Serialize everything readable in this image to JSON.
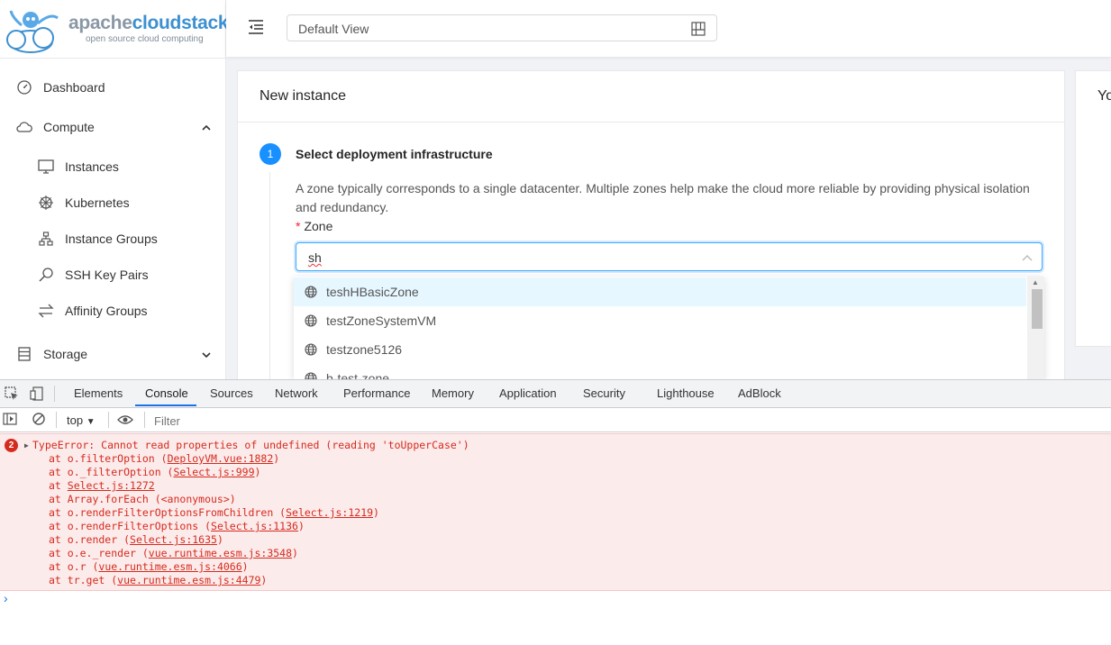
{
  "brand": {
    "name_a": "apache",
    "name_b": "cloudstack",
    "tm": "™",
    "tagline": "open source cloud computing"
  },
  "sidebar": {
    "items": [
      {
        "label": "Dashboard",
        "icon": "dashboard-icon"
      },
      {
        "label": "Compute",
        "icon": "cloud-icon",
        "expanded": true
      },
      {
        "label": "Instances",
        "icon": "desktop-icon"
      },
      {
        "label": "Kubernetes",
        "icon": "kubernetes-icon"
      },
      {
        "label": "Instance Groups",
        "icon": "cluster-icon"
      },
      {
        "label": "SSH Key Pairs",
        "icon": "key-icon"
      },
      {
        "label": "Affinity Groups",
        "icon": "swap-icon"
      },
      {
        "label": "Storage",
        "icon": "database-icon",
        "expanded": false
      }
    ]
  },
  "header": {
    "view_select": "Default View"
  },
  "wizard": {
    "title": "New instance",
    "step_number": "1",
    "step_title": "Select deployment infrastructure",
    "step_desc": "A zone typically corresponds to a single datacenter. Multiple zones help make the cloud more reliable by providing physical isolation and redundancy.",
    "zone_required": "*",
    "zone_label": "Zone",
    "zone_value": "sh",
    "zone_options": [
      "teshHBasicZone",
      "testZoneSystemVM",
      "testzone5126",
      "b-test-zone"
    ]
  },
  "side_card": {
    "title_fragment": "Yo"
  },
  "devtools": {
    "tabs": [
      "Elements",
      "Console",
      "Sources",
      "Network",
      "Performance",
      "Memory",
      "Application",
      "Security",
      "Lighthouse",
      "AdBlock"
    ],
    "active_tab": "Console",
    "context": "top",
    "filter_placeholder": "Filter",
    "error_count": "2",
    "error_message": "TypeError: Cannot read properties of undefined (reading 'toUpperCase')",
    "trace": [
      {
        "prefix": "at o.filterOption (",
        "link": "DeployVM.vue:1882",
        "suffix": ")"
      },
      {
        "prefix": "at o._filterOption (",
        "link": "Select.js:999",
        "suffix": ")"
      },
      {
        "prefix": "at ",
        "link": "Select.js:1272",
        "suffix": ""
      },
      {
        "prefix": "at Array.forEach (<anonymous>)",
        "link": "",
        "suffix": ""
      },
      {
        "prefix": "at o.renderFilterOptionsFromChildren (",
        "link": "Select.js:1219",
        "suffix": ")"
      },
      {
        "prefix": "at o.renderFilterOptions (",
        "link": "Select.js:1136",
        "suffix": ")"
      },
      {
        "prefix": "at o.render (",
        "link": "Select.js:1635",
        "suffix": ")"
      },
      {
        "prefix": "at o.e._render (",
        "link": "vue.runtime.esm.js:3548",
        "suffix": ")"
      },
      {
        "prefix": "at o.r (",
        "link": "vue.runtime.esm.js:4066",
        "suffix": ")"
      },
      {
        "prefix": "at tr.get (",
        "link": "vue.runtime.esm.js:4479",
        "suffix": ")"
      }
    ],
    "prompt": "›"
  },
  "colors": {
    "primary": "#1890ff",
    "error_bg": "#fcebeb",
    "error_text": "#d52b1e",
    "devtools_accent": "#1a73e8"
  }
}
